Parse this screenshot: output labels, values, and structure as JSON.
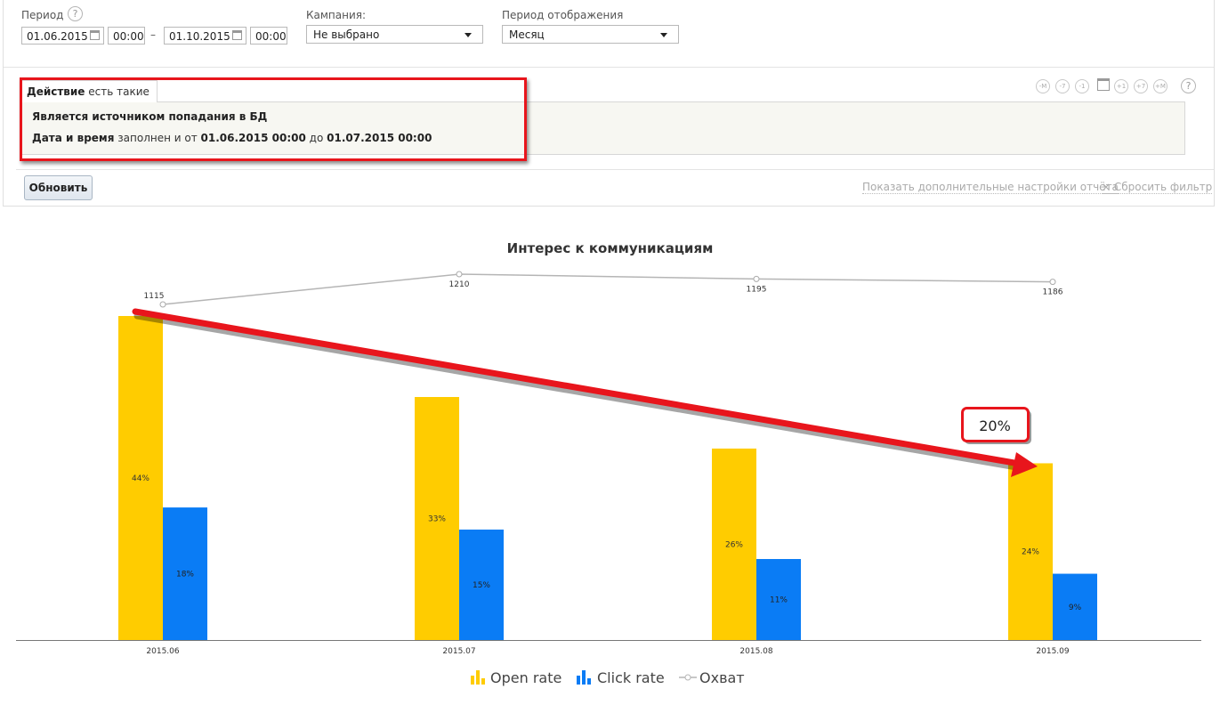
{
  "filters": {
    "period_label": "Период",
    "help_glyph": "?",
    "date_from": "01.06.2015",
    "time_from": "00:00",
    "date_separator": "–",
    "date_to": "01.10.2015",
    "time_to": "00:00",
    "campaign_label": "Кампания:",
    "campaign_value": "Не выбрано",
    "display_period_label": "Период отображения",
    "display_period_value": "Месяц"
  },
  "filter_panel": {
    "tab_bold": "Действие",
    "tab_rest": "есть такие",
    "row1_bold": "Является источником попадания в БД",
    "row2_b1": "Дата и время",
    "row2_t1": "заполнен и от",
    "row2_b2": "01.06.2015 00:00",
    "row2_t2": "до",
    "row2_b3": "01.07.2015 00:00"
  },
  "nav_buttons": [
    "-M",
    "-7",
    "-1",
    "+1",
    "+7",
    "+M"
  ],
  "actions": {
    "update_button": "Обновить",
    "more_settings_link": "Показать дополнительные настройки отчёта",
    "reset_filter_link": "× Сбросить фильтр"
  },
  "chart_data": {
    "type": "bar",
    "title": "Интерес к коммуникациям",
    "categories": [
      "2015.06",
      "2015.07",
      "2015.08",
      "2015.09"
    ],
    "series": [
      {
        "name": "Open rate",
        "type": "bar",
        "color": "#ffcc00",
        "values": [
          44,
          33,
          26,
          24
        ],
        "labels": [
          "44%",
          "33%",
          "26%",
          "24%"
        ]
      },
      {
        "name": "Click rate",
        "type": "bar",
        "color": "#0a7cf5",
        "values": [
          18,
          15,
          11,
          9
        ],
        "labels": [
          "18%",
          "15%",
          "11%",
          "9%"
        ]
      },
      {
        "name": "Охват",
        "type": "line",
        "color": "#b5b5b5",
        "values": [
          1115,
          1210,
          1195,
          1186
        ],
        "labels": [
          "1115",
          "1210",
          "1195",
          "1186"
        ]
      }
    ],
    "bar_ylim": [
      0,
      44
    ],
    "line_ylim": [
      0,
      1210
    ],
    "legend_position": "bottom",
    "annotation": {
      "text": "20%",
      "color": "#e8151c"
    }
  }
}
